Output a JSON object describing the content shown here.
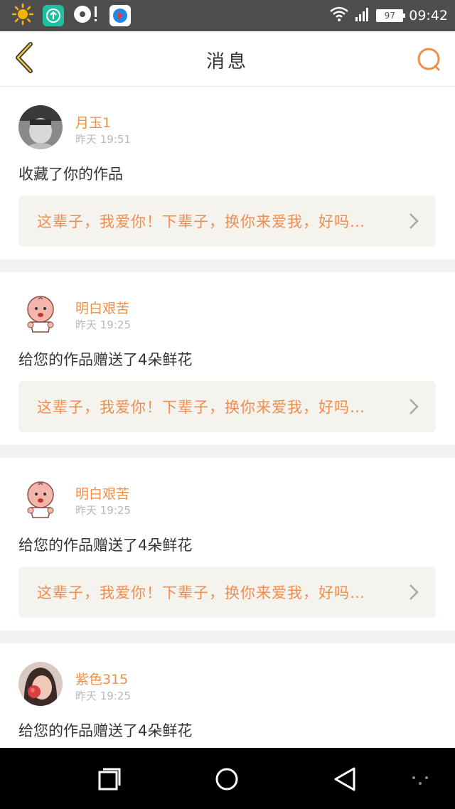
{
  "status_bar": {
    "time": "09:42",
    "battery": "97",
    "icons": [
      "weather-sun-icon",
      "upload-app-icon",
      "music-app-icon",
      "video-app-icon",
      "wifi-icon",
      "signal-icon"
    ]
  },
  "header": {
    "title": "消息",
    "back_icon": "back-arrow-icon",
    "search_icon": "search-icon"
  },
  "messages": [
    {
      "user": "月玉1",
      "time": "昨天 19:51",
      "action": "收藏了你的作品",
      "work": "这辈子，我爱你！下辈子，换你来爱我，好吗…",
      "avatar": "avatar-photo-gray"
    },
    {
      "user": "明白艰苦",
      "time": "昨天 19:25",
      "action": "给您的作品赠送了4朵鲜花",
      "work": "这辈子，我爱你！下辈子，换你来爱我，好吗…",
      "avatar": "avatar-baby-cartoon"
    },
    {
      "user": "明白艰苦",
      "time": "昨天 19:25",
      "action": "给您的作品赠送了4朵鲜花",
      "work": "这辈子，我爱你！下辈子，换你来爱我，好吗…",
      "avatar": "avatar-baby-cartoon"
    },
    {
      "user": "紫色315",
      "time": "昨天 19:25",
      "action": "给您的作品赠送了4朵鲜花",
      "work": "",
      "avatar": "avatar-photo-girl"
    }
  ],
  "nav_bar": {
    "buttons": [
      "recent-apps-icon",
      "home-icon",
      "back-triangle-icon",
      "more-dots-icon"
    ]
  },
  "colors": {
    "accent": "#f08f4a",
    "status_bar": "#4e4e4e",
    "work_box": "#f4f3ee"
  }
}
